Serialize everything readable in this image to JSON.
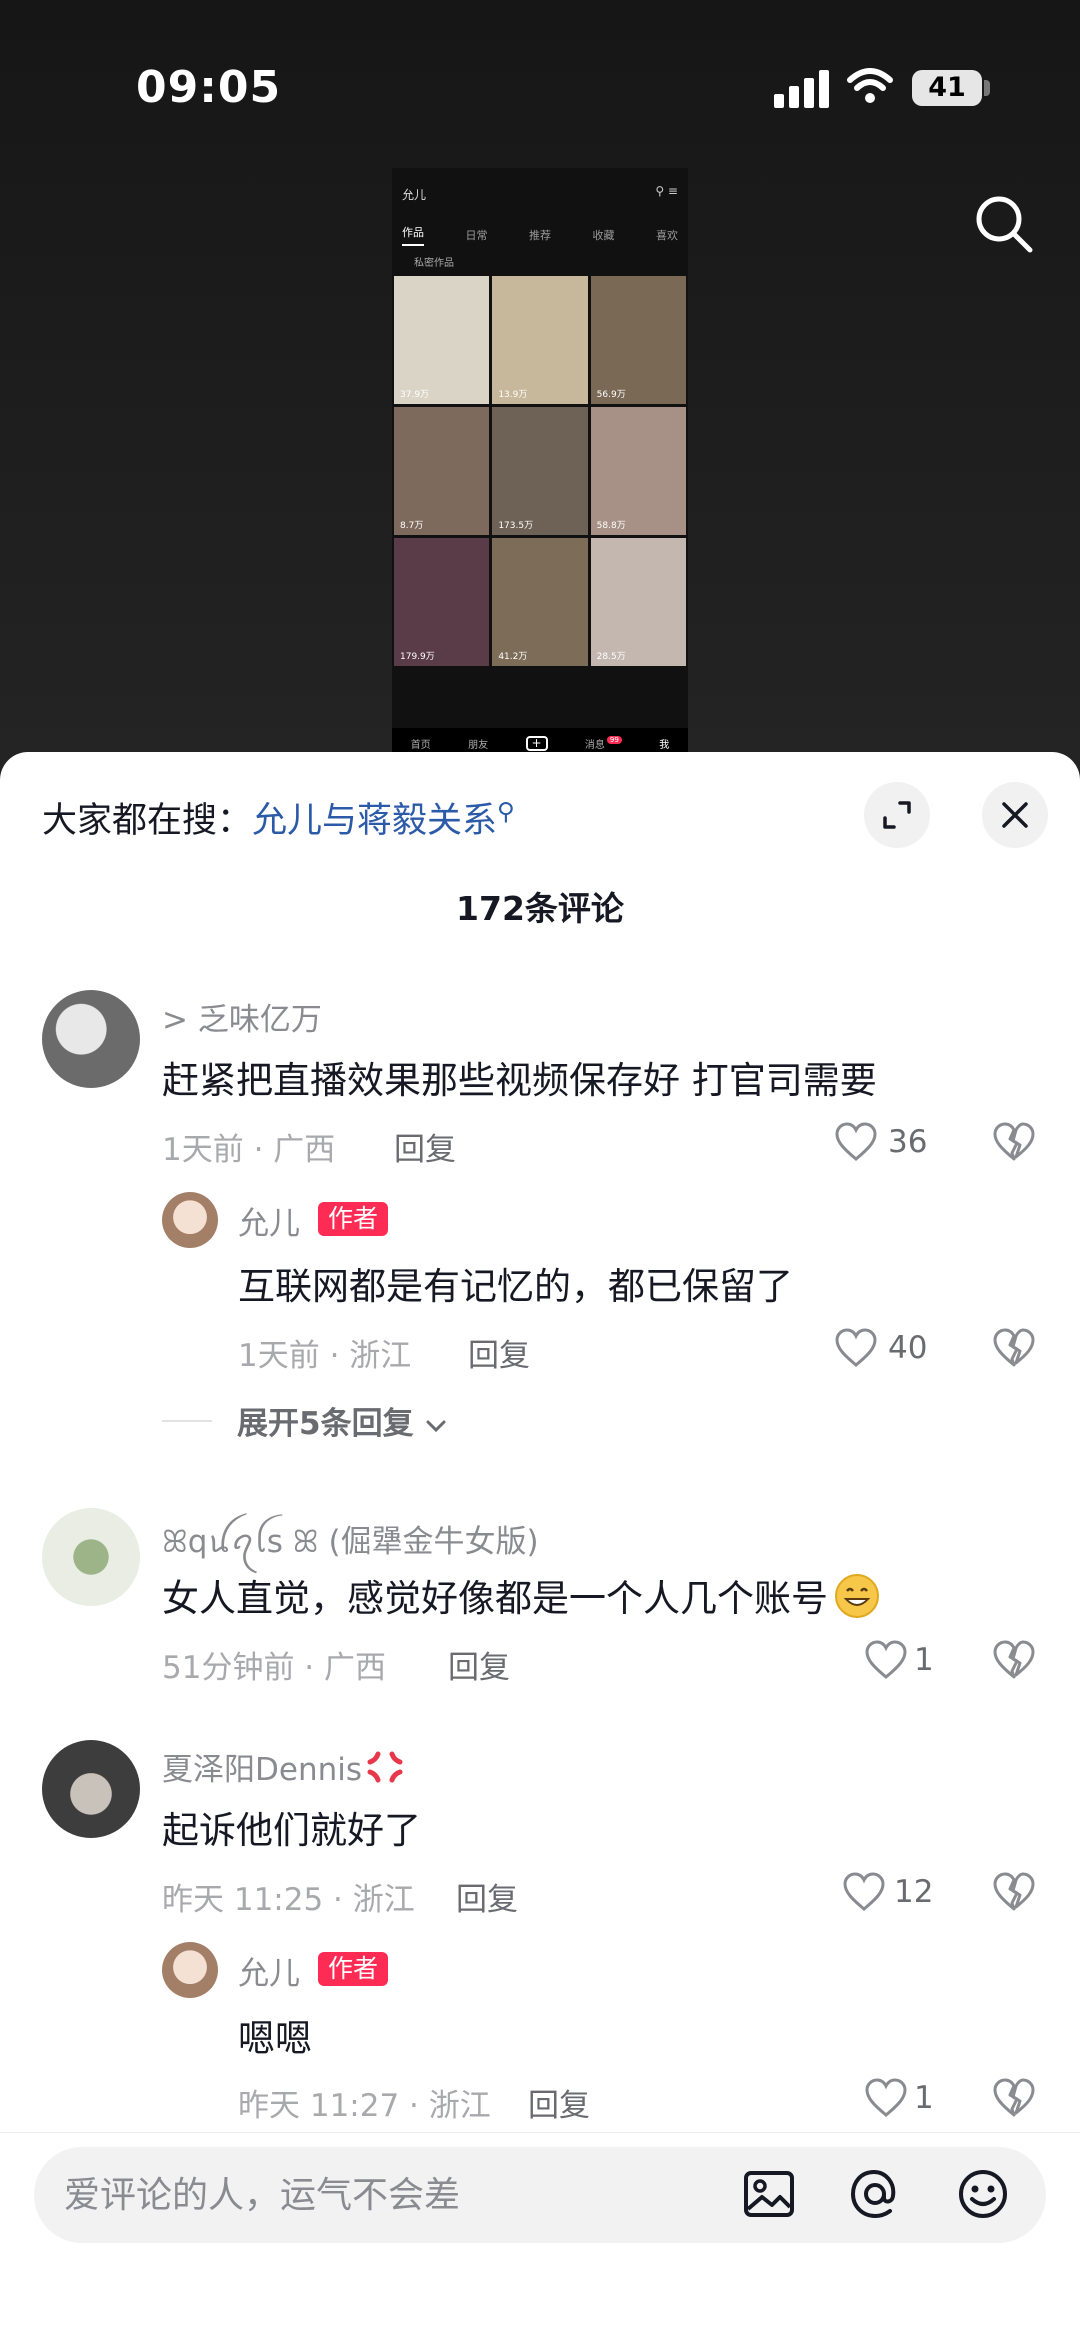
{
  "status_bar": {
    "time": "09:05",
    "battery": "41"
  },
  "preview": {
    "profile_name": "允儿",
    "tabs": [
      "作品",
      "日常",
      "推荐",
      "收藏",
      "喜欢"
    ],
    "sub_label": "私密作品",
    "cells": [
      {
        "views": "37.9万",
        "color": "#d9d4c6"
      },
      {
        "views": "13.9万",
        "color": "#c7b79b"
      },
      {
        "views": "56.9万",
        "color": "#7a6a55"
      },
      {
        "views": "8.7万",
        "color": "#7d6a5c"
      },
      {
        "views": "173.5万",
        "color": "#6e6257"
      },
      {
        "views": "58.8万",
        "color": "#a79186"
      },
      {
        "views": "179.9万",
        "color": "#5a3b48"
      },
      {
        "views": "41.2万",
        "color": "#7d6c57"
      },
      {
        "views": "28.5万",
        "color": "#c4b7b0"
      }
    ],
    "nav": [
      "首页",
      "朋友",
      "+",
      "消息",
      "我"
    ],
    "nav_badge": "99"
  },
  "sheet": {
    "search_prefix": "大家都在搜：",
    "search_keyword": "允儿与蒋毅关系",
    "comment_count": "172条评论",
    "expand_replies": "展开5条回复"
  },
  "comments": [
    {
      "user": "> 乏味亿万",
      "text": "赶紧把直播效果那些视频保存好 打官司需要",
      "time_loc": "1天前 · 广西",
      "reply": "回复",
      "likes": "36",
      "avatar_color": "#6b6b6b"
    },
    {
      "user": "允儿",
      "author_tag": "作者",
      "text": "互联网都是有记忆的，都已保留了",
      "time_loc": "1天前 · 浙江",
      "reply": "回复",
      "likes": "40",
      "avatar_color": "#d8c2b3"
    },
    {
      "user": "ꕤqꪊꪖꪶs ꕤ (倔犟金牛女版)",
      "text": "女人直觉，感觉好像都是一个人几个账号",
      "time_loc": "51分钟前 · 广西",
      "reply": "回复",
      "likes": "1",
      "avatar_color": "#7e9a6a"
    },
    {
      "user": "夏泽阳Dennis",
      "text": "起诉他们就好了",
      "time_loc": "昨天 11:25 · 浙江",
      "reply": "回复",
      "likes": "12",
      "avatar_color": "#4a4a4a"
    },
    {
      "user": "允儿",
      "author_tag": "作者",
      "text": "嗯嗯",
      "time_loc": "昨天 11:27 · 浙江",
      "reply": "回复",
      "likes": "1",
      "avatar_color": "#d8c2b3"
    }
  ],
  "input": {
    "placeholder": "爱评论的人，运气不会差"
  },
  "colors": {
    "accent_red": "#fe2c55",
    "keyword_blue": "#2b5aa8"
  }
}
